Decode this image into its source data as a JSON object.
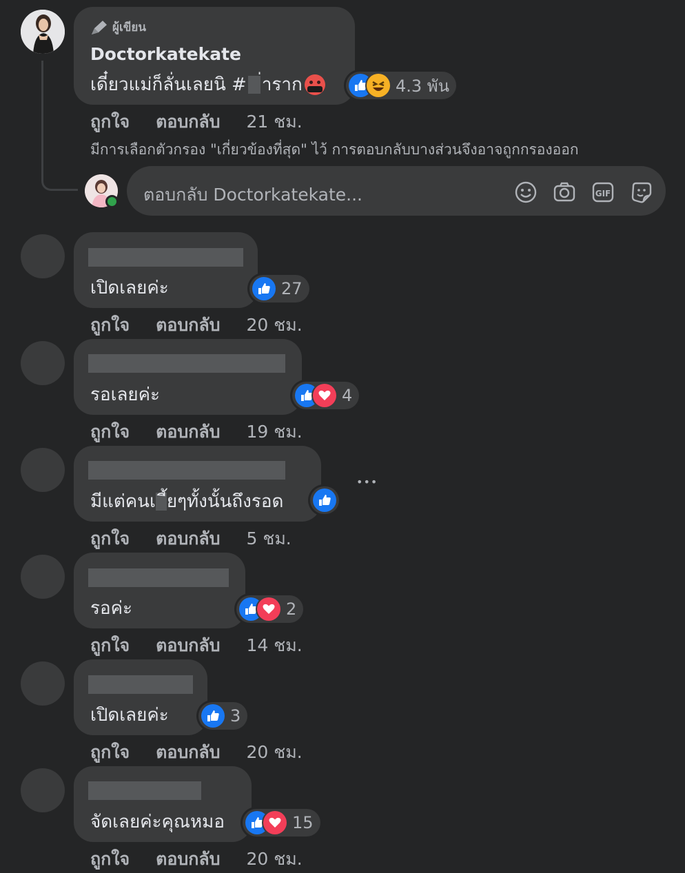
{
  "author_comment": {
    "badge": "ผู้เขียน",
    "name": "Doctorkatekate",
    "text_part1": "เดี๋ยวแม่ก็ลั่นเลยนิ #",
    "text_part2": "่าราก",
    "reaction_count": "4.3 พัน",
    "reactions": [
      "like-icon",
      "haha-icon"
    ],
    "like_label": "ถูกใจ",
    "reply_label": "ตอบกลับ",
    "time": "21 ชม."
  },
  "filter_notice": "มีการเลือกตัวกรอง \"เกี่ยวข้องที่สุด\" ไว้ การตอบกลับบางส่วนจึงอาจถูกกรองออก",
  "reply_box": {
    "placeholder": "ตอบกลับ Doctorkatekate...",
    "tools": [
      "emoji-icon",
      "camera-icon",
      "gif-icon",
      "sticker-icon"
    ]
  },
  "replies": [
    {
      "text": "เปิดเลยค่ะ",
      "reactions": [
        "like"
      ],
      "count": "27",
      "like_label": "ถูกใจ",
      "reply_label": "ตอบกลับ",
      "time": "20 ชม."
    },
    {
      "text": "รอเลยค่ะ",
      "reactions": [
        "like",
        "love"
      ],
      "count": "4",
      "like_label": "ถูกใจ",
      "reply_label": "ตอบกลับ",
      "time": "19 ชม."
    },
    {
      "text_part1": "มีแต่คนเ",
      "text_part2": "ี้ยๆทั้งนั้นถึงรอด",
      "reactions": [
        "like"
      ],
      "count": "",
      "like_label": "ถูกใจ",
      "reply_label": "ตอบกลับ",
      "time": "5 ชม.",
      "more": "•••"
    },
    {
      "text": "รอค่ะ",
      "reactions": [
        "like",
        "love"
      ],
      "count": "2",
      "like_label": "ถูกใจ",
      "reply_label": "ตอบกลับ",
      "time": "14 ชม."
    },
    {
      "text": "เปิดเลยค่ะ",
      "reactions": [
        "like"
      ],
      "count": "3",
      "like_label": "ถูกใจ",
      "reply_label": "ตอบกลับ",
      "time": "20 ชม."
    },
    {
      "text": "จัดเลยค่ะคุณหมอ",
      "reactions": [
        "like",
        "love"
      ],
      "count": "15",
      "like_label": "ถูกใจ",
      "reply_label": "ตอบกลับ",
      "time": "20 ชม."
    }
  ],
  "colors": {
    "background": "#242526",
    "bubble": "#3a3b3c",
    "like": "#1877f2",
    "love": "#f33e58",
    "online": "#31a24c"
  }
}
